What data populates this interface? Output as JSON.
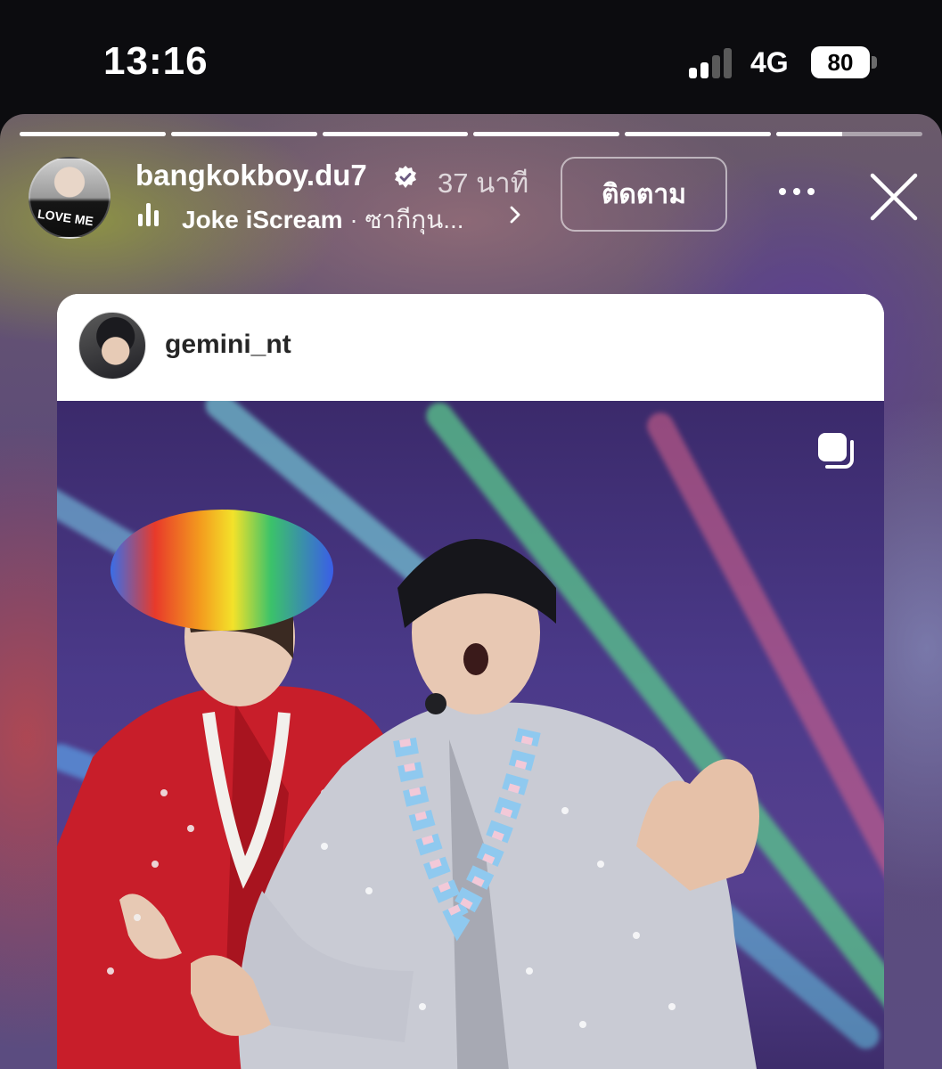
{
  "status_bar": {
    "time": "13:16",
    "network": "4G",
    "battery": "80"
  },
  "story": {
    "progress": [
      1,
      1,
      1,
      1,
      1,
      0.45
    ],
    "account": {
      "username": "bangkokboy.du7",
      "verified": true,
      "time_ago": "37 นาที",
      "avatar_shirt_text": "LOVE ME"
    },
    "music": {
      "artist": "Joke iScream",
      "separator": " · ",
      "title": "ซากีกุน..."
    },
    "follow_label": "ติดตาม",
    "icons": {
      "more": "more-horizontal-icon",
      "close": "close-icon",
      "music": "music-bars-icon",
      "verified": "verified-badge-icon",
      "chevron": "chevron-right-icon"
    }
  },
  "shared_post": {
    "username": "gemini_nt",
    "icons": {
      "multi": "carousel-multiple-icon"
    }
  },
  "colors": {
    "background": "#0c0c0f",
    "follow_border": "rgba(255,255,255,0.55)",
    "card": "#ffffff"
  }
}
